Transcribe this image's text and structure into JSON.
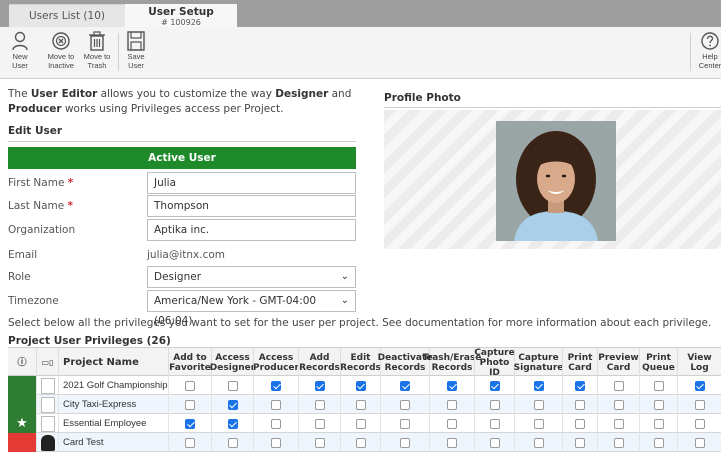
{
  "tabs": [
    {
      "label": "Users List (10)"
    },
    {
      "label": "User Setup",
      "sub": "# 100926"
    }
  ],
  "toolbar": {
    "new_user": [
      "New",
      "User"
    ],
    "move_inactive": [
      "Move to",
      "Inactive"
    ],
    "move_trash": [
      "Move to",
      "Trash"
    ],
    "save_user": [
      "Save",
      "User"
    ],
    "help_center": [
      "Help",
      "Center"
    ]
  },
  "intro": {
    "p1": "The ",
    "b1": "User Editor",
    "p2": " allows you to customize the way ",
    "b2": "Designer",
    "p3": " and ",
    "b3": "Producer",
    "p4": " works using Privileges access per Project."
  },
  "edit_user": {
    "title": "Edit User",
    "status_banner": "Active User",
    "fields": {
      "first_name": {
        "label": "First Name",
        "required": "*",
        "value": "Julia"
      },
      "last_name": {
        "label": "Last Name",
        "required": "*",
        "value": "Thompson"
      },
      "organization": {
        "label": "Organization",
        "value": "Aptika inc."
      },
      "email": {
        "label": "Email",
        "value": "julia@itnx.com"
      },
      "role": {
        "label": "Role",
        "value": "Designer"
      },
      "timezone": {
        "label": "Timezone",
        "value": "America/New York - GMT-04:00 (06:04)"
      }
    }
  },
  "profile_photo": {
    "title": "Profile Photo"
  },
  "privileges": {
    "instruction": "Select below all the privileges you want to set for the user per project. See documentation for more information about each privilege.",
    "title": "Project User Privileges (26)",
    "columns": [
      "ⓘ",
      "▭▯",
      "Project Name",
      "Add to Favorite",
      "Access Designer",
      "Access Producer",
      "Add Records",
      "Edit Records",
      "Deactivate Records",
      "Trash/Erase Records",
      "Capture Photo ID",
      "Capture Signature",
      "Print Card",
      "Preview Card",
      "Print Queue",
      "View Log"
    ],
    "rows": [
      {
        "name": "2021 Golf Championship",
        "status_color": "#2e7d32",
        "starred": false,
        "checks": [
          false,
          false,
          true,
          true,
          true,
          true,
          true,
          true,
          true,
          true,
          false,
          false,
          true
        ]
      },
      {
        "name": "City Taxi-Express",
        "status_color": "#2e7d32",
        "starred": false,
        "checks": [
          false,
          true,
          false,
          false,
          false,
          false,
          false,
          false,
          false,
          false,
          false,
          false,
          false
        ]
      },
      {
        "name": "Essential Employee",
        "status_color": "#2e7d32",
        "starred": true,
        "checks": [
          true,
          true,
          false,
          false,
          false,
          false,
          false,
          false,
          false,
          false,
          false,
          false,
          false
        ]
      },
      {
        "name": "Card Test",
        "status_color": "#e53935",
        "starred": false,
        "checks": [
          false,
          false,
          false,
          false,
          false,
          false,
          false,
          false,
          false,
          false,
          false,
          false,
          false
        ]
      }
    ]
  },
  "colors": {
    "active_green": "#1f8a2a",
    "required_red": "#d32f2f",
    "check_blue": "#1a73e8"
  }
}
